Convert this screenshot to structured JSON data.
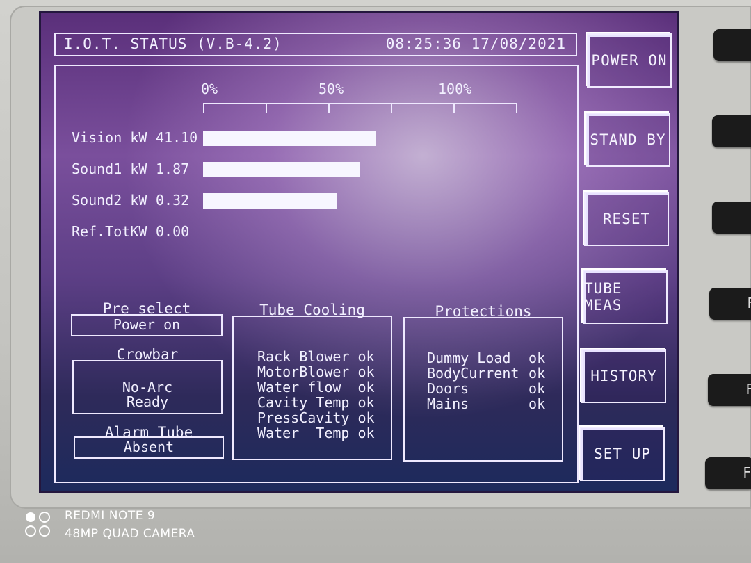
{
  "header": {
    "title": "I.O.T. STATUS (V.B-4.2)",
    "time": "08:25:36",
    "date": "17/08/2021"
  },
  "scale": {
    "labels": [
      "0%",
      "50%",
      "100%"
    ]
  },
  "meters": [
    {
      "label": "Vision kW",
      "value": "41.10",
      "fraction": 0.55
    },
    {
      "label": "Sound1 kW",
      "value": "1.87",
      "fraction": 0.5
    },
    {
      "label": "Sound2 kW",
      "value": "0.32",
      "fraction": 0.425
    },
    {
      "label": "Ref.TotKW",
      "value": "0.00",
      "fraction": 0.0
    }
  ],
  "preselect": {
    "title": "Pre select",
    "value": "Power on"
  },
  "crowbar": {
    "title": "Crowbar",
    "line1": "No-Arc",
    "line2": "Ready"
  },
  "alarm_tube": {
    "title": "Alarm Tube",
    "value": "Absent"
  },
  "tube_cooling": {
    "title": "Tube Cooling",
    "items": [
      {
        "name": "Rack Blower",
        "status": "ok"
      },
      {
        "name": "MotorBlower",
        "status": "ok"
      },
      {
        "name": "Water flow",
        "status": "ok"
      },
      {
        "name": "Cavity Temp",
        "status": "ok"
      },
      {
        "name": "PressCavity",
        "status": "ok"
      },
      {
        "name": "Water  Temp",
        "status": "ok"
      }
    ]
  },
  "protections": {
    "title": "Protections",
    "items": [
      {
        "name": "Dummy Load",
        "status": "ok"
      },
      {
        "name": "BodyCurrent",
        "status": "ok"
      },
      {
        "name": "Doors",
        "status": "ok"
      },
      {
        "name": "Mains",
        "status": "ok"
      }
    ]
  },
  "buttons": [
    "POWER ON",
    "STAND BY",
    "RESET",
    "TUBE MEAS",
    "HISTORY",
    "SET UP"
  ],
  "side_keys": [
    "",
    "",
    "",
    "F",
    "F",
    "F"
  ],
  "camera_caption": {
    "line1": "REDMI NOTE 9",
    "line2": "48MP QUAD CAMERA"
  }
}
